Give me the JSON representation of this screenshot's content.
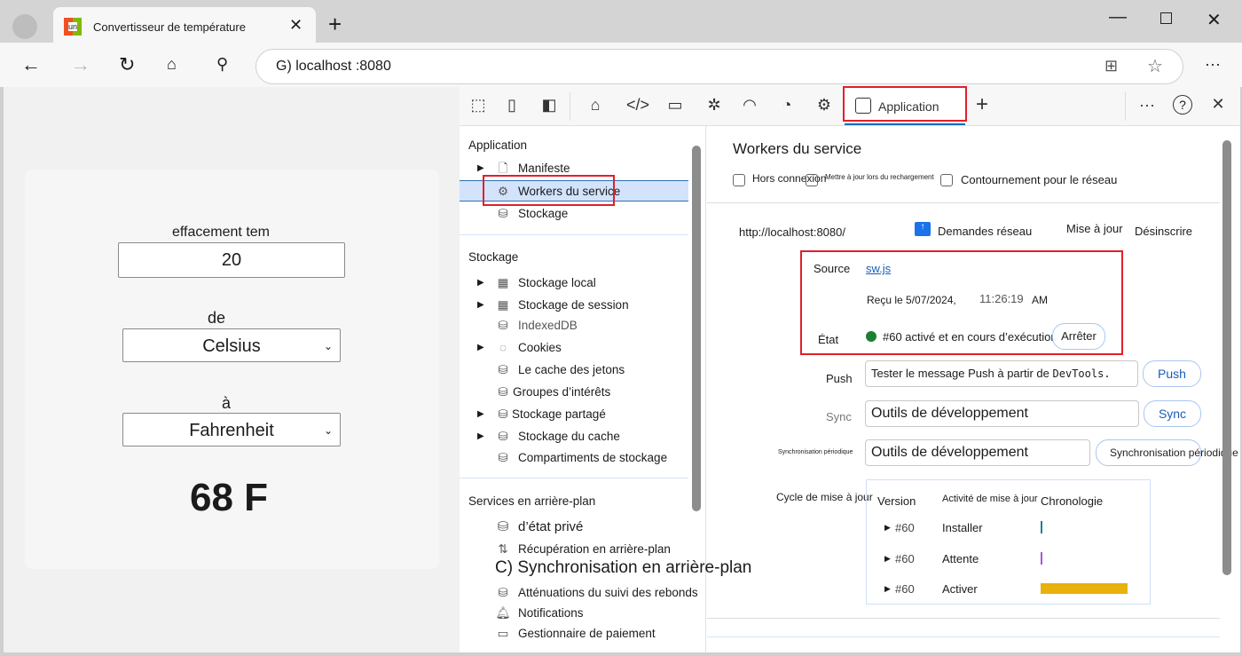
{
  "browser": {
    "tab_title": "Convertisseur de température",
    "favicon_text": "un",
    "address": "G) localhost :8080"
  },
  "page": {
    "label1": "effacement tem",
    "value1": "20",
    "label2": "de",
    "from_unit": "Celsius",
    "label3": "à",
    "to_unit": "Fahrenheit",
    "result": "68 F"
  },
  "devtools": {
    "active_tab": "Application",
    "sidebar": {
      "section1": "Application",
      "app_items": [
        "Manifeste",
        "Workers du service",
        "Stockage"
      ],
      "section2": "Stockage",
      "storage_items": [
        "Stockage local",
        "Stockage de session",
        "IndexedDB",
        "Cookies",
        "Le cache des jetons",
        "Groupes d’intérêts",
        "Stockage partagé",
        "Stockage du cache",
        "Compartiments de stockage"
      ],
      "section3": "Services en arrière-plan",
      "bg_items": [
        "d’état privé",
        "Récupération en arrière-plan",
        "C) Synchronisation en arrière-plan",
        "Atténuations du suivi des rebonds",
        "Notifications",
        "Gestionnaire de paiement"
      ]
    },
    "main": {
      "title": "Workers du service",
      "cb_offline": "Hors connexion",
      "cb_update": "Mettre à jour lors du rechargement",
      "cb_bypass": "Contournement pour le réseau",
      "origin": "http://localhost:8080/",
      "network_requests": "Demandes réseau",
      "update": "Mise à jour",
      "unregister": "Désinscrire",
      "source_label": "Source",
      "source_link": "sw.js",
      "received": "Reçu le 5/07/2024,",
      "received_time": "11:26:19",
      "received_ampm": "AM",
      "status_label": "État",
      "status_text": "#60 activé et en cours d’exécution",
      "status_color": "#1e7e34",
      "stop": "Arrêter",
      "push_label": "Push",
      "push_value": "Tester le message Push à partir de",
      "push_value_mono": "DevTools.",
      "push_btn": "Push",
      "sync_label": "Sync",
      "sync_value": "Outils de développement",
      "sync_btn": "Sync",
      "psync_label": "Synchronisation périodique",
      "psync_value": "Outils de développement",
      "psync_btn": "Synchronisation périodique",
      "cycle_label": "Cycle de mise à jour",
      "col_version": "Version",
      "col_activity": "Activité de mise à jour",
      "col_timeline": "Chronologie",
      "rows": [
        {
          "version": "#60",
          "activity": "Installer",
          "color": "#1a7fa0"
        },
        {
          "version": "#60",
          "activity": "Attente",
          "color": "#a855d8"
        },
        {
          "version": "#60",
          "activity": "Activer",
          "color": "#e8b10c"
        }
      ]
    }
  }
}
